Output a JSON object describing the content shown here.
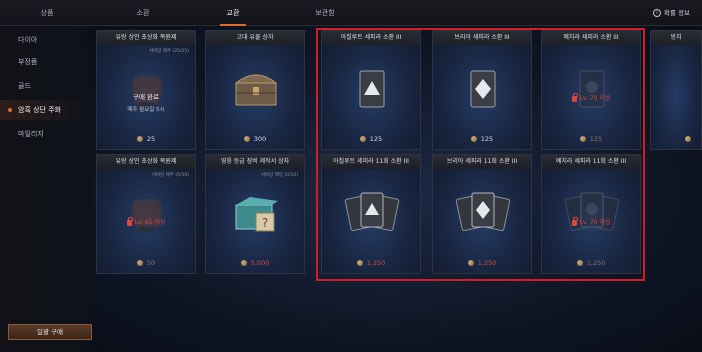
{
  "topbar": {
    "tabs": [
      {
        "label": "상품",
        "active": false
      },
      {
        "label": "소환",
        "active": false
      },
      {
        "label": "교환",
        "active": true
      },
      {
        "label": "보관함",
        "active": false
      }
    ],
    "prob_info": "확률 정보"
  },
  "sidebar": {
    "items": [
      {
        "label": "다이아",
        "active": false
      },
      {
        "label": "부장품",
        "active": false
      },
      {
        "label": "골드",
        "active": false
      },
      {
        "label": "암흑 상단 주화",
        "active": true
      },
      {
        "label": "마일리지",
        "active": false
      }
    ],
    "bulk_button": "일괄 구매"
  },
  "cards": [
    {
      "title": "유랑 상인 초상화 복원제",
      "sub": "서버당 매주 (25/25)",
      "purchased": "구매 완료",
      "reset": "매주 월요일 5시",
      "price": "25",
      "art": "urn-icon"
    },
    {
      "title": "고대 유물 상자",
      "sub": "",
      "price": "300",
      "art": "chest-icon"
    },
    {
      "title": "아칠루트 세피라 소환 III",
      "sub": "",
      "price": "125",
      "art": "card-triangle-icon"
    },
    {
      "title": "브리아 세피라 소환 III",
      "sub": "",
      "price": "125",
      "art": "card-diamond-icon"
    },
    {
      "title": "예치라 세피라 소환 III",
      "sub": "",
      "lock": "Lv. 70 이상",
      "price": "125",
      "art": "card-dark-icon"
    },
    {
      "title": "방치",
      "sub": "",
      "price": "",
      "art": "partial-card"
    },
    {
      "title": "유랑 상인 초상화 복원제",
      "sub": "서버당 매주 (0/50)",
      "lock": "Lv. 65 이상",
      "price": "50",
      "art": "urn-icon"
    },
    {
      "title": "영웅 등급 장비 제작서 상자",
      "sub": "서버당 매일 (0/10)",
      "price": "5,000",
      "art": "scroll-box-icon"
    },
    {
      "title": "아칠루트 세피라 11회 소환 III",
      "sub": "",
      "price": "1,250",
      "art": "card-stack-triangle-icon"
    },
    {
      "title": "브리아 세피라 11회 소환 III",
      "sub": "",
      "price": "1,250",
      "art": "card-stack-diamond-icon"
    },
    {
      "title": "예치라 세피라 11회 소환 III",
      "sub": "",
      "lock": "Lv. 70 이상",
      "price": "1,250",
      "art": "card-stack-dark-icon"
    }
  ],
  "colors": {
    "accent": "#e06a2a",
    "highlight": "#d11e24",
    "price_red": "#d64a3a"
  }
}
